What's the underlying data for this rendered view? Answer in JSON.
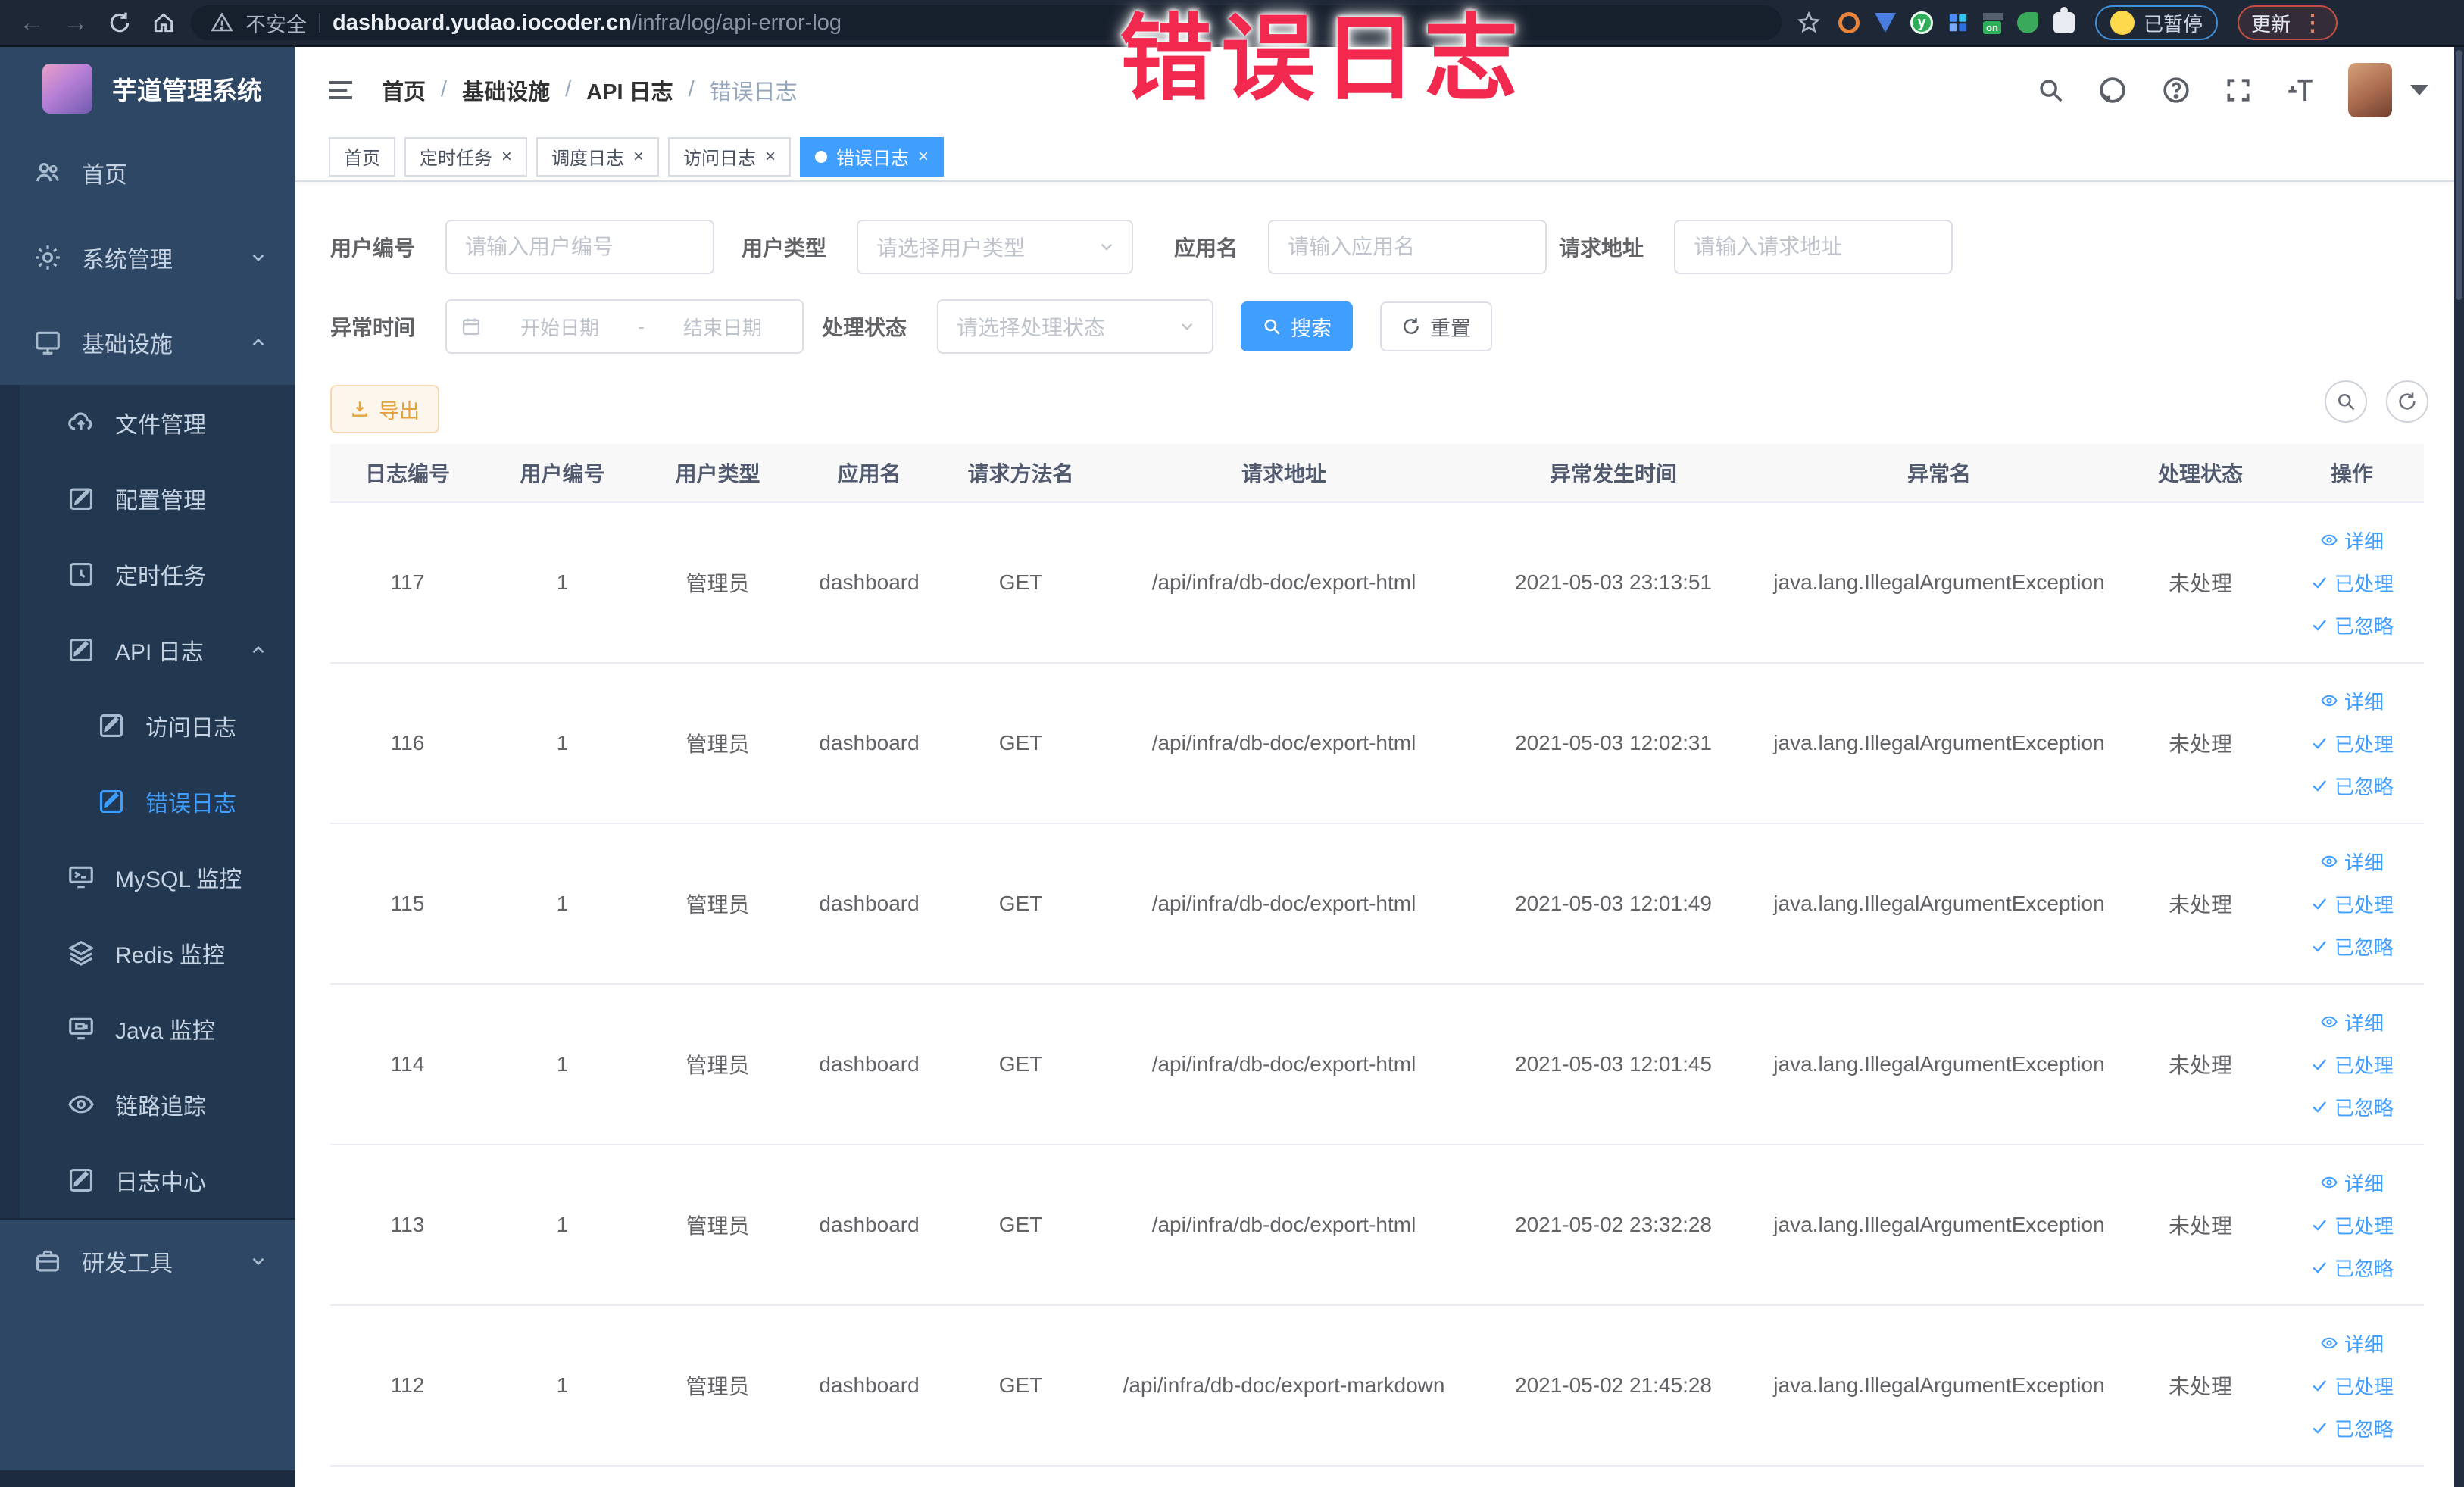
{
  "browser": {
    "security_label": "不安全",
    "url_domain": "dashboard.yudao.iocoder.cn",
    "url_path": "/infra/log/api-error-log",
    "paused_label": "已暂停",
    "update_label": "更新"
  },
  "overlay_note": {
    "text": "错误日志",
    "color": "#f1294f"
  },
  "sidebar": {
    "title": "芋道管理系统",
    "items": [
      {
        "label": "首页"
      },
      {
        "label": "系统管理"
      },
      {
        "label": "基础设施"
      },
      {
        "label": "文件管理"
      },
      {
        "label": "配置管理"
      },
      {
        "label": "定时任务"
      },
      {
        "label": "API 日志"
      },
      {
        "label": "访问日志"
      },
      {
        "label": "错误日志"
      },
      {
        "label": "MySQL 监控"
      },
      {
        "label": "Redis 监控"
      },
      {
        "label": "Java 监控"
      },
      {
        "label": "链路追踪"
      },
      {
        "label": "日志中心"
      },
      {
        "label": "研发工具"
      }
    ]
  },
  "breadcrumb": [
    "首页",
    "基础设施",
    "API 日志",
    "错误日志"
  ],
  "tabs": [
    {
      "label": "首页",
      "closable": false,
      "active": false
    },
    {
      "label": "定时任务",
      "closable": true,
      "active": false
    },
    {
      "label": "调度日志",
      "closable": true,
      "active": false
    },
    {
      "label": "访问日志",
      "closable": true,
      "active": false
    },
    {
      "label": "错误日志",
      "closable": true,
      "active": true
    }
  ],
  "filters": {
    "user_id_label": "用户编号",
    "user_id_placeholder": "请输入用户编号",
    "user_type_label": "用户类型",
    "user_type_placeholder": "请选择用户类型",
    "app_label": "应用名",
    "app_placeholder": "请输入应用名",
    "url_label": "请求地址",
    "url_placeholder": "请输入请求地址",
    "time_label": "异常时间",
    "time_start_placeholder": "开始日期",
    "time_separator": "-",
    "time_end_placeholder": "结束日期",
    "status_label": "处理状态",
    "status_placeholder": "请选择处理状态",
    "search_label": "搜索",
    "reset_label": "重置"
  },
  "toolbar": {
    "export_label": "导出"
  },
  "table": {
    "columns": [
      "日志编号",
      "用户编号",
      "用户类型",
      "应用名",
      "请求方法名",
      "请求地址",
      "异常发生时间",
      "异常名",
      "处理状态",
      "操作"
    ],
    "actions": [
      "详细",
      "已处理",
      "已忽略"
    ],
    "rows": [
      {
        "id": "117",
        "user_id": "1",
        "user_type": "管理员",
        "app": "dashboard",
        "method": "GET",
        "url": "/api/infra/db-doc/export-html",
        "time": "2021-05-03 23:13:51",
        "exception": "java.lang.IllegalArgumentException",
        "status": "未处理"
      },
      {
        "id": "116",
        "user_id": "1",
        "user_type": "管理员",
        "app": "dashboard",
        "method": "GET",
        "url": "/api/infra/db-doc/export-html",
        "time": "2021-05-03 12:02:31",
        "exception": "java.lang.IllegalArgumentException",
        "status": "未处理"
      },
      {
        "id": "115",
        "user_id": "1",
        "user_type": "管理员",
        "app": "dashboard",
        "method": "GET",
        "url": "/api/infra/db-doc/export-html",
        "time": "2021-05-03 12:01:49",
        "exception": "java.lang.IllegalArgumentException",
        "status": "未处理"
      },
      {
        "id": "114",
        "user_id": "1",
        "user_type": "管理员",
        "app": "dashboard",
        "method": "GET",
        "url": "/api/infra/db-doc/export-html",
        "time": "2021-05-03 12:01:45",
        "exception": "java.lang.IllegalArgumentException",
        "status": "未处理"
      },
      {
        "id": "113",
        "user_id": "1",
        "user_type": "管理员",
        "app": "dashboard",
        "method": "GET",
        "url": "/api/infra/db-doc/export-html",
        "time": "2021-05-02 23:32:28",
        "exception": "java.lang.IllegalArgumentException",
        "status": "未处理"
      },
      {
        "id": "112",
        "user_id": "1",
        "user_type": "管理员",
        "app": "dashboard",
        "method": "GET",
        "url": "/api/infra/db-doc/export-markdown",
        "time": "2021-05-02 21:45:28",
        "exception": "java.lang.IllegalArgumentException",
        "status": "未处理"
      }
    ]
  }
}
